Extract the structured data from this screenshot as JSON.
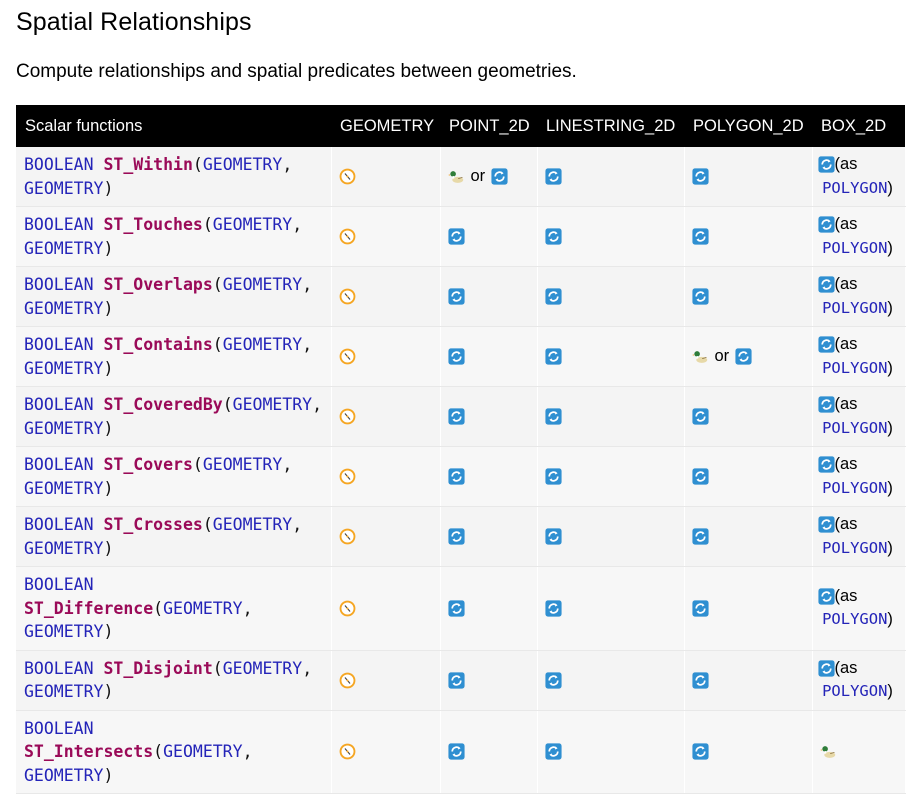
{
  "page": {
    "title": "Spatial Relationships",
    "subtitle": "Compute relationships and spatial predicates between geometries."
  },
  "table": {
    "headers": [
      "Scalar functions",
      "GEOMETRY",
      "POINT_2D",
      "LINESTRING_2D",
      "POLYGON_2D",
      "BOX_2D"
    ],
    "or_text": "or",
    "as_text": "(as",
    "polygon_text": "POLYGON",
    "close_paren": ")",
    "rows": [
      {
        "ret": "BOOLEAN",
        "name": "ST_Within",
        "args": "(GEOMETRY, GEOMETRY)",
        "geometry": "fallback",
        "point": "inline-or-native",
        "linestring": "native",
        "polygon": "native",
        "box": "as-polygon"
      },
      {
        "ret": "BOOLEAN",
        "name": "ST_Touches",
        "args": "(GEOMETRY, GEOMETRY)",
        "geometry": "fallback",
        "point": "native",
        "linestring": "native",
        "polygon": "native",
        "box": "as-polygon"
      },
      {
        "ret": "BOOLEAN",
        "name": "ST_Overlaps",
        "args": "(GEOMETRY, GEOMETRY)",
        "geometry": "fallback",
        "point": "native",
        "linestring": "native",
        "polygon": "native",
        "box": "as-polygon"
      },
      {
        "ret": "BOOLEAN",
        "name": "ST_Contains",
        "args": "(GEOMETRY, GEOMETRY)",
        "geometry": "fallback",
        "point": "native",
        "linestring": "native",
        "polygon": "inline-or-native",
        "box": "as-polygon"
      },
      {
        "ret": "BOOLEAN",
        "name": "ST_CoveredBy",
        "args": "(GEOMETRY, GEOMETRY)",
        "geometry": "fallback",
        "point": "native",
        "linestring": "native",
        "polygon": "native",
        "box": "as-polygon"
      },
      {
        "ret": "BOOLEAN",
        "name": "ST_Covers",
        "args": "(GEOMETRY, GEOMETRY)",
        "geometry": "fallback",
        "point": "native",
        "linestring": "native",
        "polygon": "native",
        "box": "as-polygon"
      },
      {
        "ret": "BOOLEAN",
        "name": "ST_Crosses",
        "args": "(GEOMETRY, GEOMETRY)",
        "geometry": "fallback",
        "point": "native",
        "linestring": "native",
        "polygon": "native",
        "box": "as-polygon"
      },
      {
        "ret": "BOOLEAN",
        "name": "ST_Difference",
        "args": "(GEOMETRY, GEOMETRY)",
        "geometry": "fallback",
        "point": "native",
        "linestring": "native",
        "polygon": "native",
        "box": "as-polygon"
      },
      {
        "ret": "BOOLEAN",
        "name": "ST_Disjoint",
        "args": "(GEOMETRY, GEOMETRY)",
        "geometry": "fallback",
        "point": "native",
        "linestring": "native",
        "polygon": "native",
        "box": "as-polygon"
      },
      {
        "ret": "BOOLEAN",
        "name": "ST_Intersects",
        "args": "(GEOMETRY, GEOMETRY)",
        "geometry": "fallback",
        "point": "native",
        "linestring": "native",
        "polygon": "native",
        "box": "inline"
      }
    ]
  },
  "colors": {
    "header_bg": "#000000",
    "keyword": "#2424b8",
    "function_name": "#9a0a58",
    "native_icon": "#2f8fd1",
    "fallback_icon": "#f5a623"
  },
  "icons": {
    "native": "refresh-icon",
    "fallback": "compass-icon",
    "inline": "duck-icon"
  }
}
